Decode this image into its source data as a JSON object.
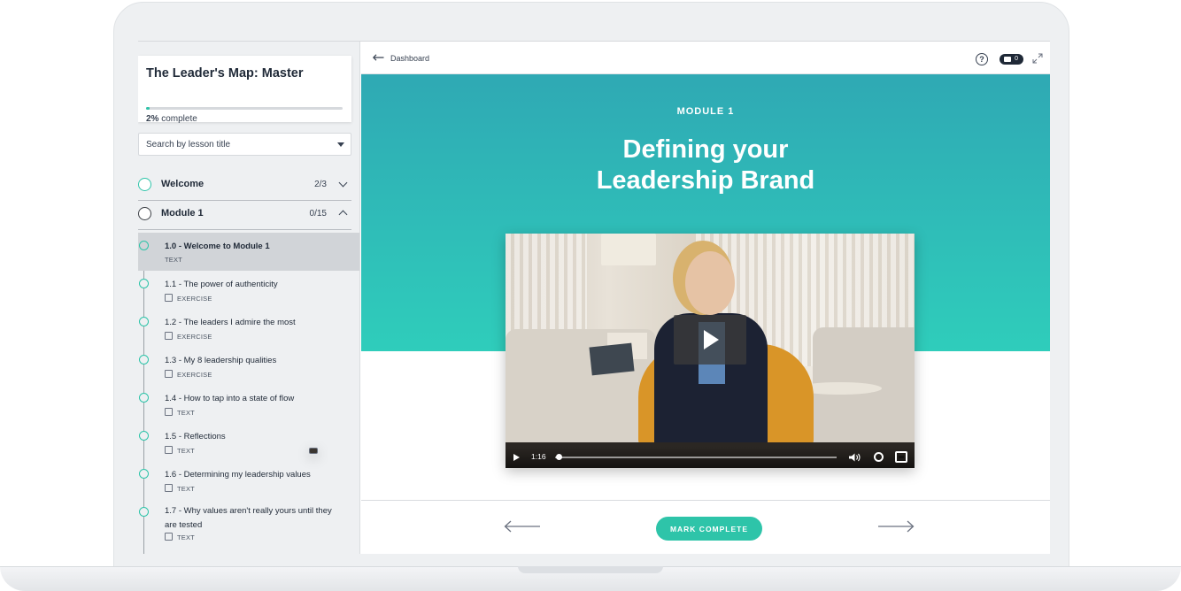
{
  "course": {
    "title": "The Leader's Map: Master",
    "progress_percent": 2,
    "progress_value": "2%",
    "progress_suffix": " complete"
  },
  "search": {
    "placeholder": "Search by lesson title"
  },
  "sections": [
    {
      "label": "Welcome",
      "count": "2/3",
      "expanded": false
    },
    {
      "label": "Module 1",
      "count": "0/15",
      "expanded": true
    }
  ],
  "lessons": [
    {
      "title": "1.0 - Welcome to Module 1",
      "type": "TEXT",
      "icon": "video-icon",
      "active": true
    },
    {
      "title": "1.1 - The power of authenticity",
      "type": "EXERCISE",
      "icon": "exercise-icon"
    },
    {
      "title": "1.2 - The leaders I admire the most",
      "type": "EXERCISE",
      "icon": "exercise-icon"
    },
    {
      "title": "1.3 - My 8 leadership qualities",
      "type": "EXERCISE",
      "icon": "exercise-icon"
    },
    {
      "title": "1.4 - How to tap into a state of flow",
      "type": "TEXT",
      "icon": "text-icon"
    },
    {
      "title": "1.5 - Reflections",
      "type": "TEXT",
      "icon": "text-icon"
    },
    {
      "title": "1.6 - Determining my leadership values",
      "type": "TEXT",
      "icon": "text-icon"
    },
    {
      "title": "1.7 - Why values aren't really yours until they are tested",
      "type": "TEXT",
      "icon": "text-icon"
    }
  ],
  "topbar": {
    "back_label": "Dashboard",
    "comments_count": "0",
    "help_glyph": "?"
  },
  "hero": {
    "module_label": "MODULE 1",
    "heading_line1": "Defining your",
    "heading_line2": "Leadership Brand"
  },
  "video": {
    "current_time": "1:16",
    "progress_fraction": 0.01
  },
  "footer": {
    "mark_complete_label": "MARK COMPLETE"
  },
  "colors": {
    "accent": "#2ec4a9",
    "hero_top": "#2fa9b4",
    "hero_bottom": "#2fcdbb"
  }
}
